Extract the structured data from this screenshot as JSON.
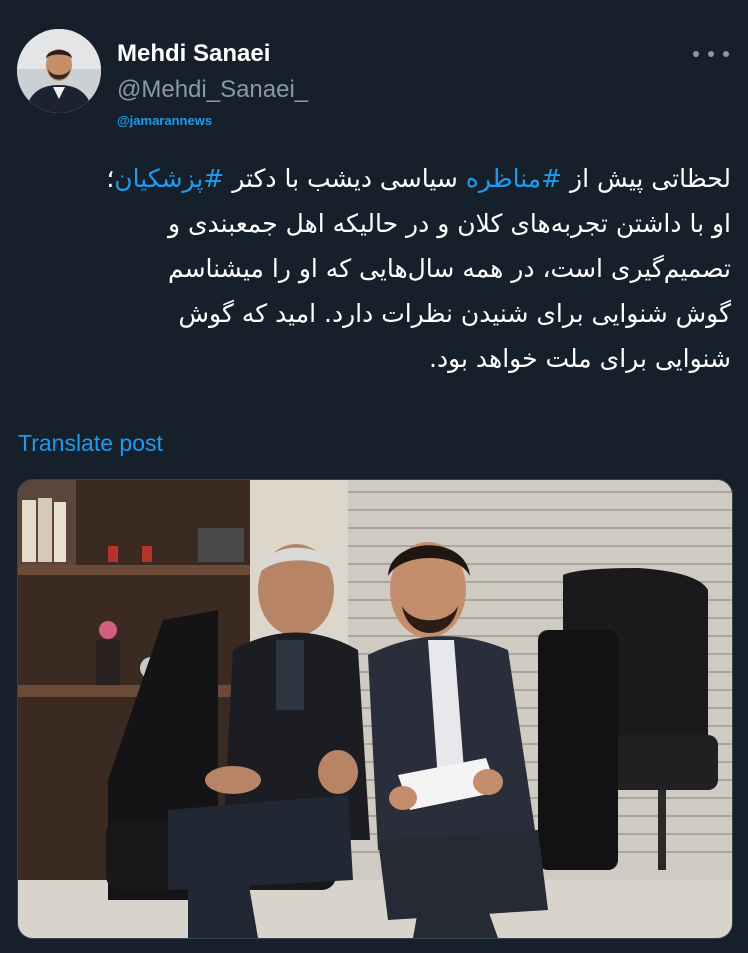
{
  "author": {
    "display_name": "Mehdi Sanaei",
    "handle": "@Mehdi_Sanaei_",
    "avatar_icon": "profile-photo"
  },
  "watermark": "@jamarannews",
  "more_icon": "ellipsis-icon",
  "tweet": {
    "line1": {
      "pre": "لحظاتی پیش از ",
      "tag1": "#مناظره",
      "mid": " سیاسی دیشب با دکتر ",
      "tag2": "#پزشکیان",
      "post": "؛"
    },
    "line2": "او با داشتن تجربه‌های کلان و در حالیکه اهل جمعبندی و",
    "line3": "تصمیم‌گیری است، در همه سال‌هایی که او را میشناسم",
    "line4": "گوش شنوایی برای شنیدن نظرات دارد. امید که گوش",
    "line5": "شنوایی برای ملت خواهد بود."
  },
  "translate_label": "Translate post",
  "colors": {
    "background": "#15202b",
    "link": "#1d9bf0",
    "secondary": "#8b98a5"
  }
}
